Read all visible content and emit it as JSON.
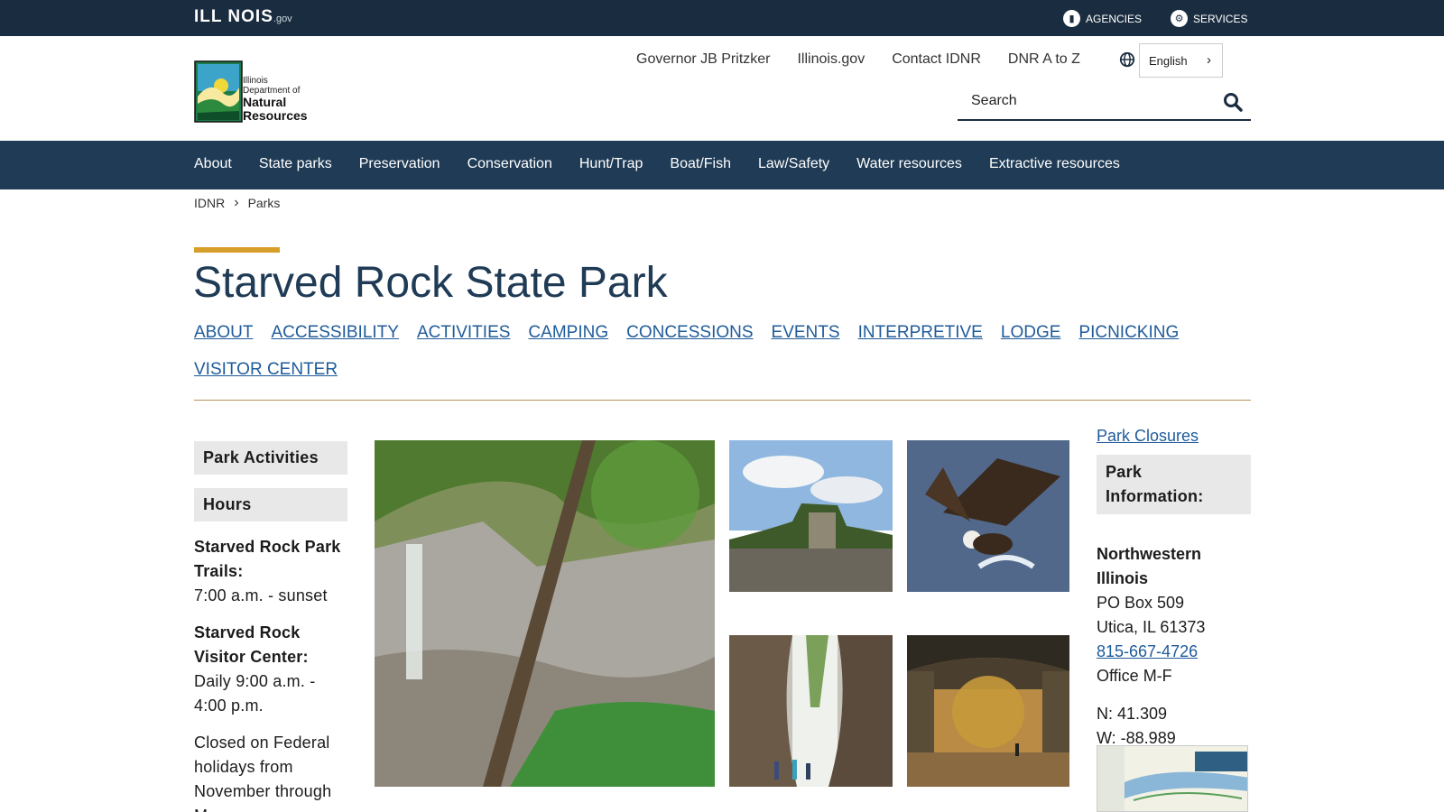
{
  "topbar": {
    "logo_text": "ILL NOIS",
    "logo_suffix": ".gov",
    "agencies_label": "AGENCIES",
    "services_label": "SERVICES"
  },
  "header": {
    "logo_line1": "Illinois",
    "logo_line2": "Department of",
    "logo_line3": "Natural",
    "logo_line4": "Resources",
    "util_links": [
      "Governor JB Pritzker",
      "Illinois.gov",
      "Contact IDNR",
      "DNR A to Z"
    ],
    "language": "English",
    "search_placeholder": "Search"
  },
  "mainnav": [
    "About",
    "State parks",
    "Preservation",
    "Conservation",
    "Hunt/Trap",
    "Boat/Fish",
    "Law/Safety",
    "Water resources",
    "Extractive resources"
  ],
  "breadcrumb": [
    "IDNR",
    "Parks"
  ],
  "page": {
    "title": "Starved Rock State Park",
    "subnav": [
      "ABOUT",
      "ACCESSIBILITY",
      "ACTIVITIES",
      "CAMPING",
      "CONCESSIONS",
      "EVENTS",
      "INTERPRETIVE",
      "LODGE",
      "PICNICKING",
      "VISITOR CENTER"
    ]
  },
  "left": {
    "activities_heading": "Park Activities",
    "hours_heading": "Hours",
    "trails_label": "Starved Rock Park Trails:",
    "trails_hours": "7:00 a.m. - sunset",
    "visitor_label": "Starved Rock Visitor Center:",
    "visitor_hours": "Daily 9:00 a.m. - 4:00 p.m.",
    "closed_note": "Closed on Federal holidays from November through Ma"
  },
  "right": {
    "closures_link": "Park Closures",
    "info_heading": "Park Information:",
    "region": "Northwestern Illinois",
    "po_box": "PO Box 509",
    "city": "Utica, IL 61373",
    "phone": "815-667-4726",
    "office": "Office M-F",
    "lat": "N: 41.309",
    "lon": "W: -88.989"
  },
  "colors": {
    "topbar": "#1a2d40",
    "mainnav": "#1f3b55",
    "accent": "#d89e2a",
    "link": "#1f5b9a"
  }
}
